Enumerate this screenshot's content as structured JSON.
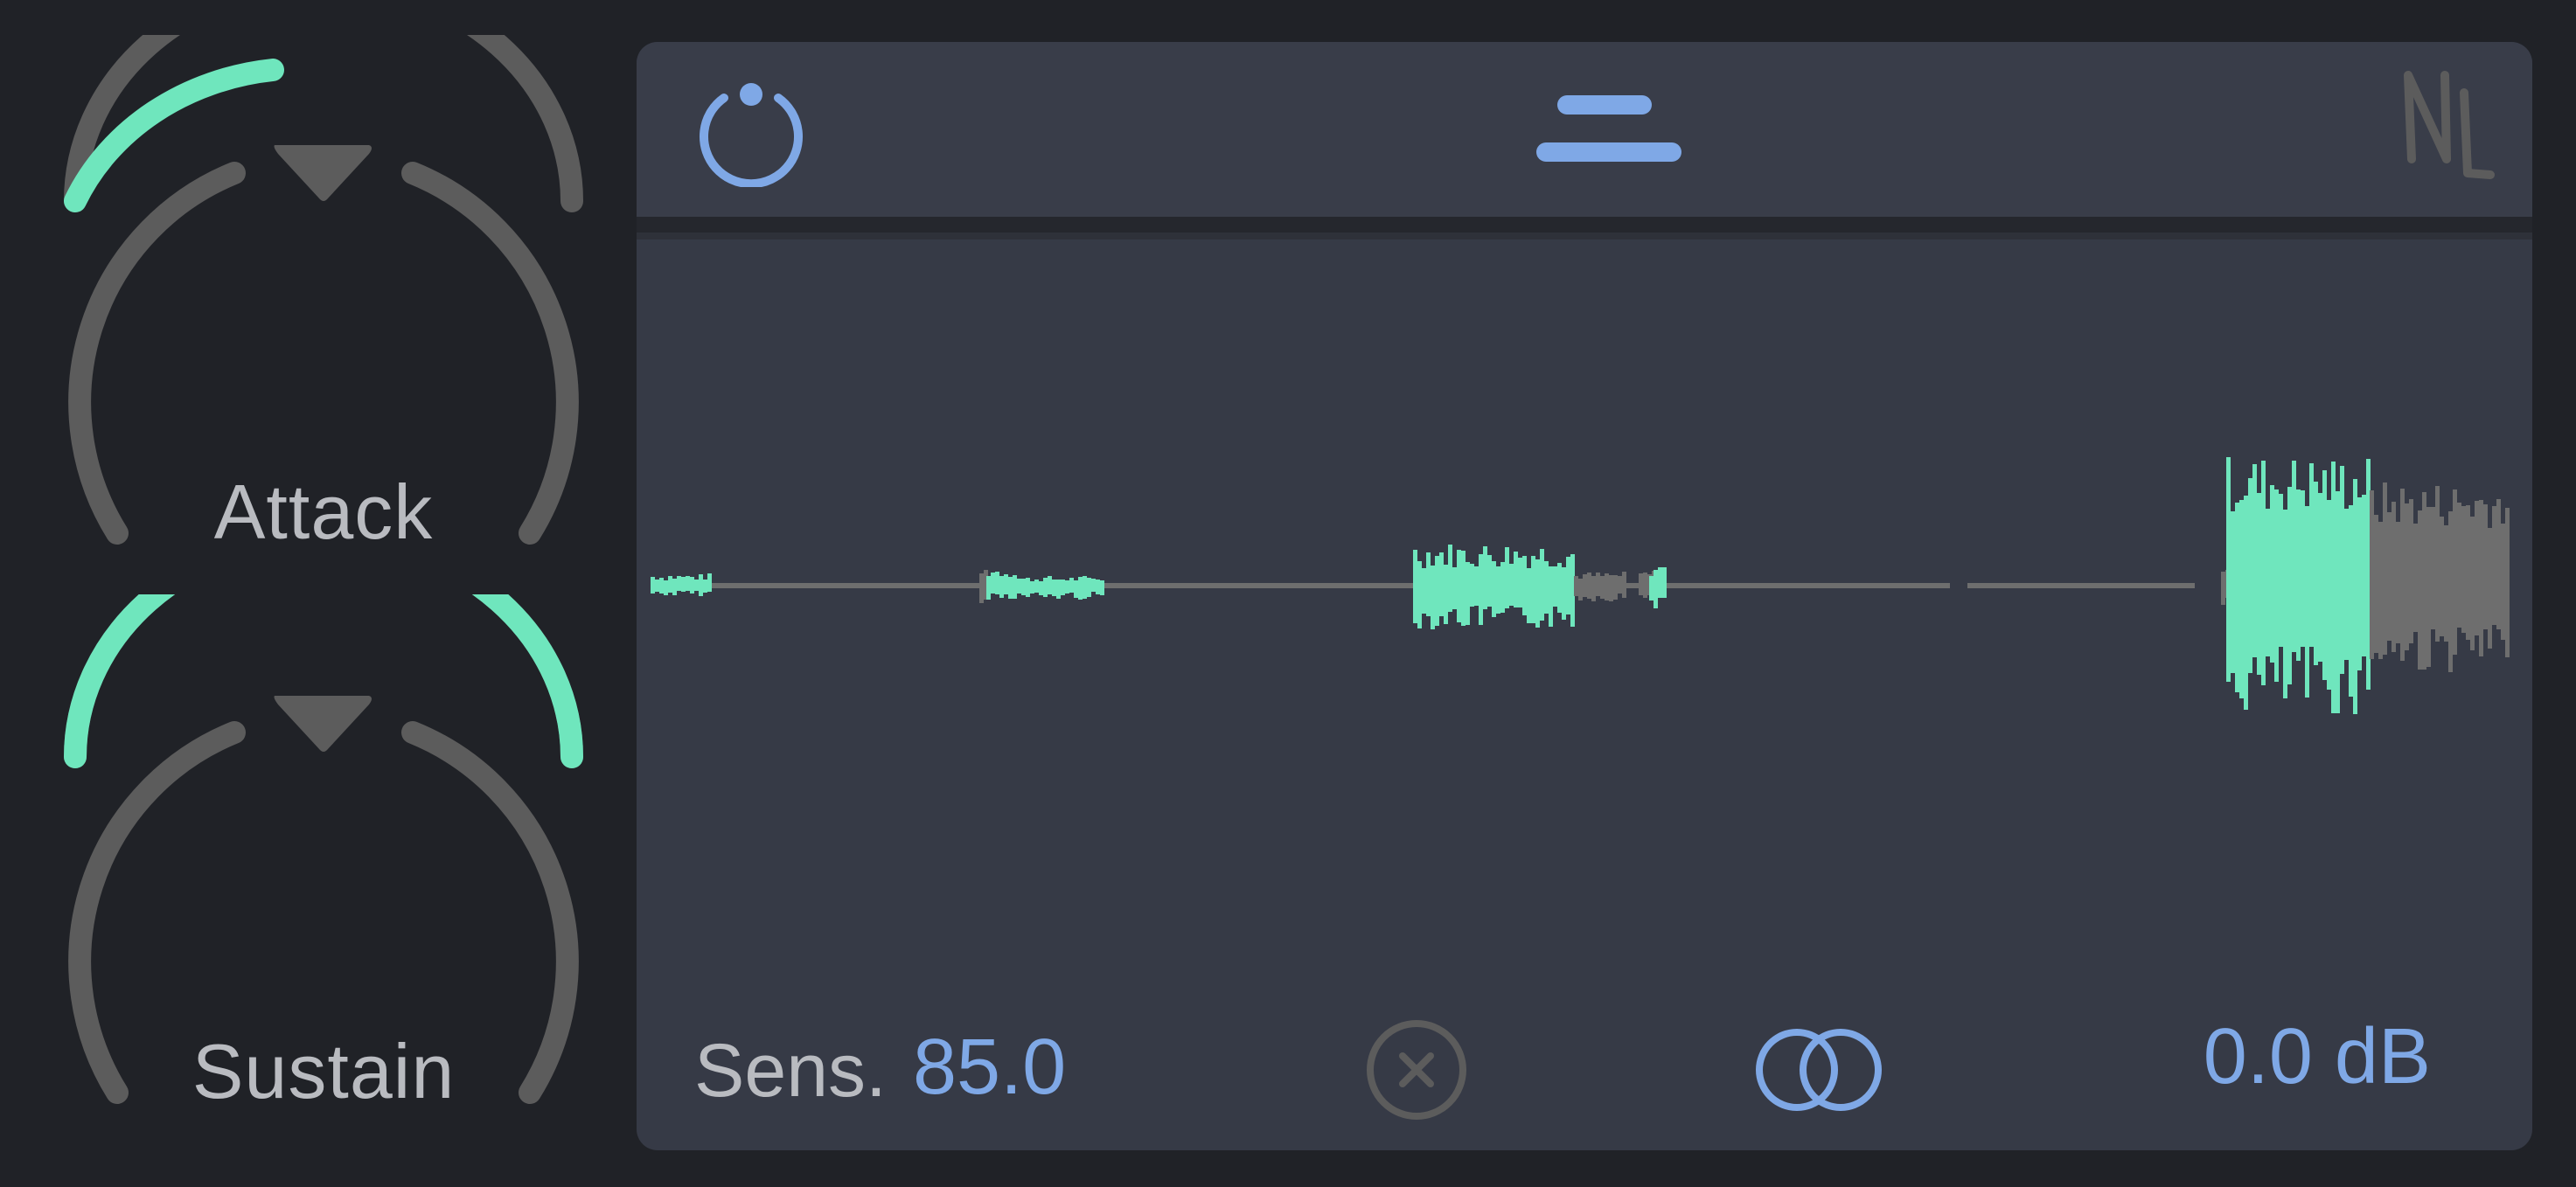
{
  "knobs": [
    {
      "label": "Attack",
      "value_fraction": 0.15
    },
    {
      "label": "Sustain",
      "value_fraction": 0.5
    }
  ],
  "header": {
    "power_icon": "power-icon",
    "menu_icon": "menu-icon",
    "logo_text": "NL"
  },
  "footer": {
    "sensitivity_label": "Sens.",
    "sensitivity_value": "85.0",
    "gain_value": "0.0 dB",
    "clear_icon": "close-circle-icon",
    "link_icon": "stereo-link-icon"
  },
  "colors": {
    "background": "#202227",
    "panel": "#363a46",
    "accent_green": "#6fe6bd",
    "accent_blue": "#7fa8e6",
    "knob_track": "#5c5c5c",
    "text_gray": "#b9bbc0"
  }
}
